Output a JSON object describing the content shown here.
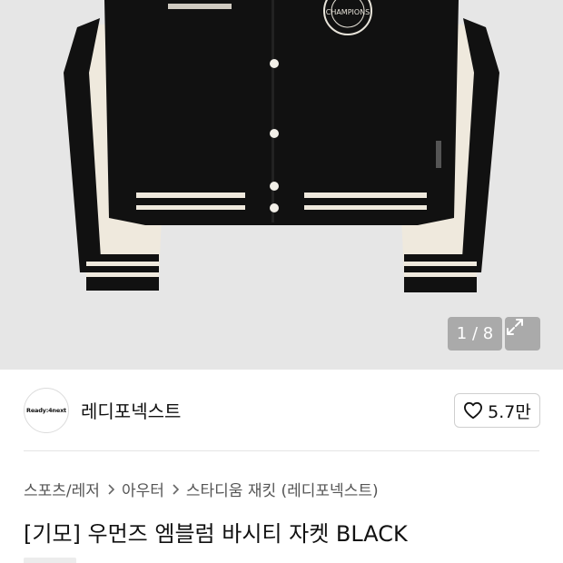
{
  "gallery": {
    "image_alt": "Varsity jacket product photo",
    "emblem_text": "CHAMPIONS",
    "page_current": "1",
    "page_total": "8",
    "page_indicator": "1 / 8"
  },
  "brand": {
    "logo_text": "Ready:4next",
    "name": "레디포넥스트",
    "like_count": "5.7만"
  },
  "breadcrumb": [
    "스포츠/레저",
    "아우터",
    "스타디움 재킷 (레디포넥스트)"
  ],
  "product": {
    "title": "[기모] 우먼즈 엠블럼 바시티 자켓 BLACK"
  },
  "colors": {
    "hero_bg": "#e6e6e6",
    "jacket_body": "#111111",
    "jacket_sleeve": "#efe9dd"
  }
}
